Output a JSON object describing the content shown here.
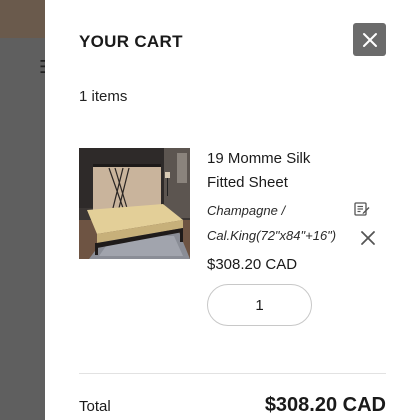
{
  "cart": {
    "title": "YOUR CART",
    "item_count": "1 items",
    "close_icon": "close-icon"
  },
  "item": {
    "name": "19 Momme Silk Fitted Sheet",
    "variant_color": "Champagne /",
    "variant_size": "Cal.King(72\"x84\"+16\")",
    "price": "$308.20 CAD",
    "quantity": "1",
    "edit_icon": "edit-icon",
    "remove_icon": "remove-icon"
  },
  "summary": {
    "total_label": "Total",
    "total_value": "$308.20 CAD"
  },
  "colors": {
    "close_button_bg": "#6b6b6b",
    "overlay": "#5f5f5f"
  }
}
